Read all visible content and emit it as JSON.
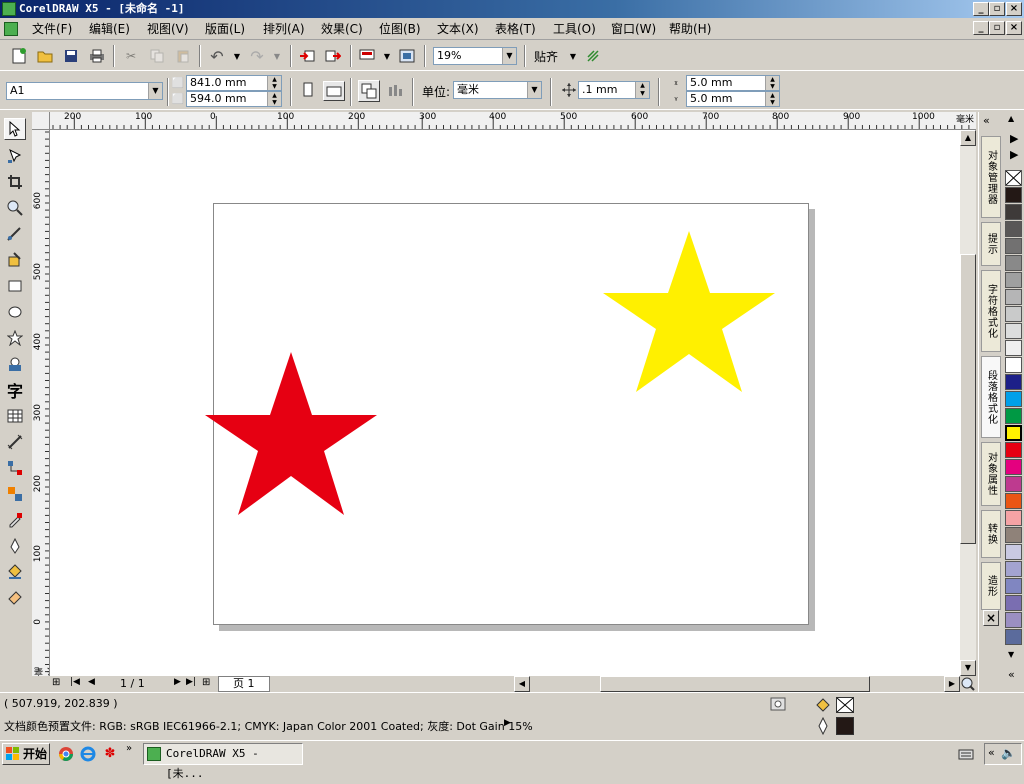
{
  "window": {
    "title": "CorelDRAW X5 - [未命名 -1]",
    "controls": [
      "_",
      "▫",
      "×"
    ]
  },
  "menu": [
    "文件(F)",
    "编辑(E)",
    "视图(V)",
    "版面(L)",
    "排列(A)",
    "效果(C)",
    "位图(B)",
    "文本(X)",
    "表格(T)",
    "工具(O)",
    "窗口(W)",
    "帮助(H)"
  ],
  "toolbar": {
    "zoom_value": "19%",
    "snap_label": "贴齐"
  },
  "propbar": {
    "paper_size": "A1",
    "width": "841.0 mm",
    "height": "594.0 mm",
    "units_label": "单位:",
    "units_value": "毫米",
    "nudge": ".1 mm",
    "dup_x": "5.0 mm",
    "dup_y": "5.0 mm"
  },
  "ruler_top": [
    "200",
    "100",
    "0",
    "100",
    "200",
    "300",
    "400",
    "500",
    "600",
    "700",
    "800",
    "900",
    "1000"
  ],
  "ruler_top_unit": "毫米",
  "ruler_left": [
    "600",
    "500",
    "400",
    "300",
    "200",
    "100",
    "0"
  ],
  "ruler_left_unit": "毫米",
  "shapes": [
    {
      "name": "red-star",
      "color": "#e60012"
    },
    {
      "name": "yellow-star",
      "color": "#fff000"
    }
  ],
  "page_nav": {
    "counter": "1 / 1",
    "page_tab": "页 1"
  },
  "dockers": [
    "对象管理器",
    "提示",
    "字符格式化",
    "段落格式化",
    "对象属性",
    "转换",
    "造形"
  ],
  "palette": [
    "none",
    "#231815",
    "#3e3a39",
    "#595757",
    "#727171",
    "#898989",
    "#9fa0a0",
    "#b5b5b6",
    "#c9caca",
    "#dcdddd",
    "#efefef",
    "#ffffff",
    "#1d2088",
    "#00a0e9",
    "#009944",
    "#fff100",
    "#e60012",
    "#e4007f",
    "#be3a8f",
    "#ea5514",
    "#f5a3a5",
    "#8f8279",
    "#c9c9e2",
    "#a3a3d0",
    "#8086c1",
    "#7a6eb1",
    "#9b8fc2",
    "#5b6b9c"
  ],
  "status": {
    "coords": "( 507.919, 202.839 )",
    "color_profile": "文档颜色预置文件: RGB: sRGB IEC61966-2.1; CMYK: Japan Color 2001 Coated; 灰度: Dot Gain 15%"
  },
  "taskbar": {
    "start_label": "开始",
    "task_label": "CorelDRAW X5 - [未..."
  }
}
